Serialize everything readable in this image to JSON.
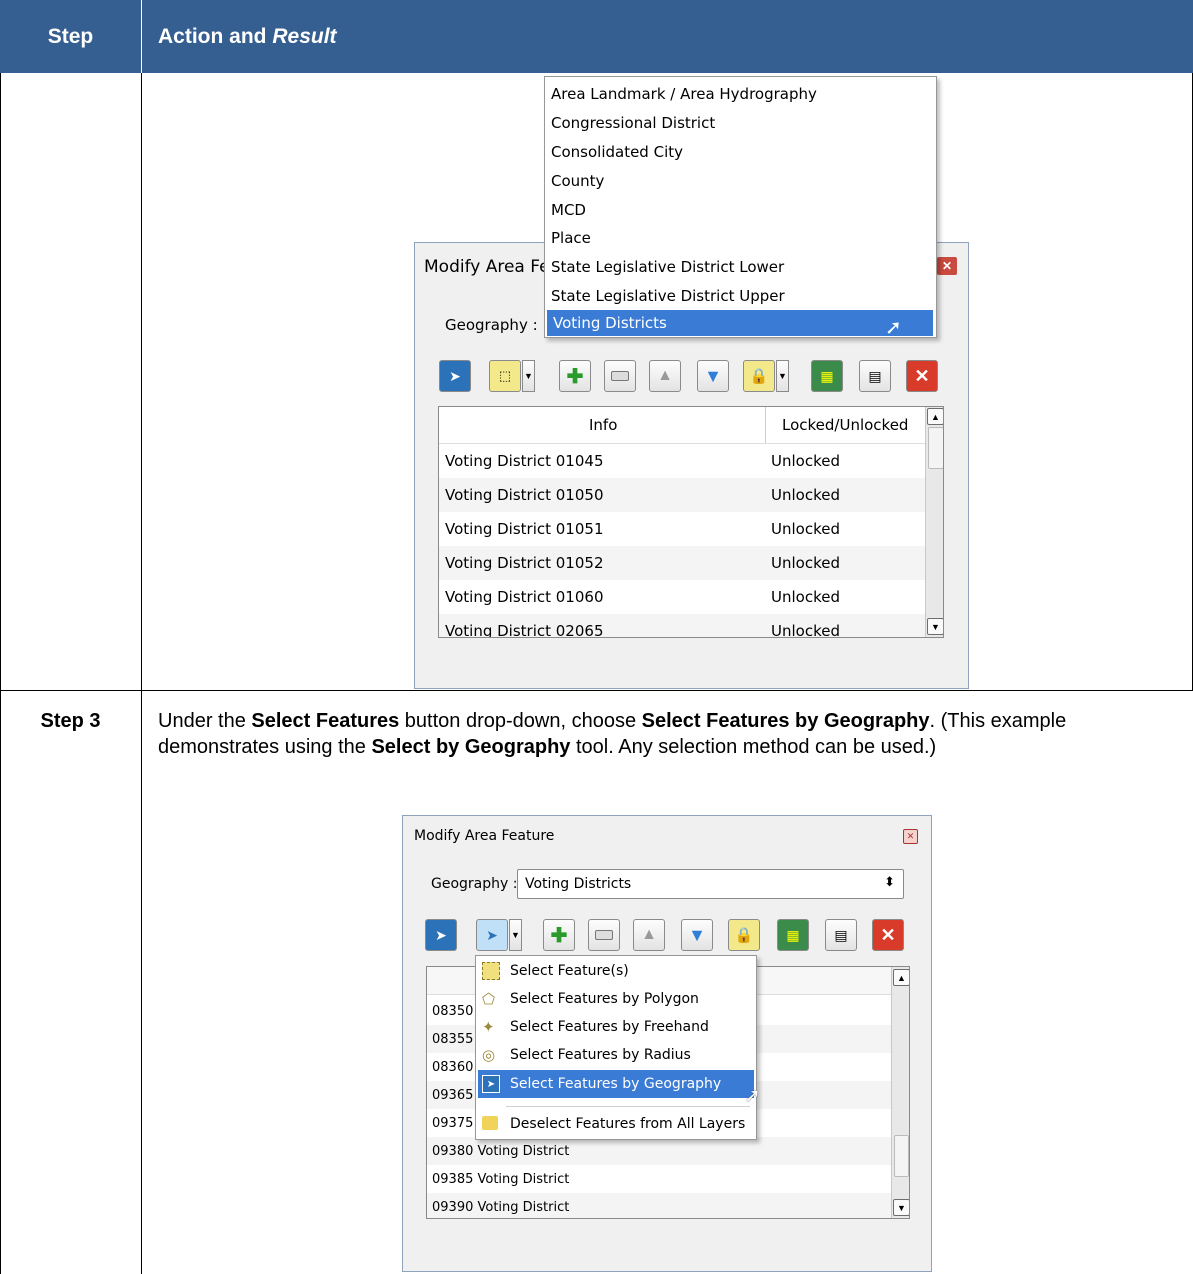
{
  "table": {
    "col_step": "Step",
    "col_action": "Action and",
    "col_action_italic": "Result"
  },
  "step3": {
    "label": "Step 3",
    "t1": "Under the ",
    "b1": "Select Features",
    "t2": " button drop-down, choose ",
    "b2": "Select Features by Geography",
    "t3": ". (This example demonstrates using the ",
    "b3": "Select by Geography",
    "t4": " tool. Any selection method can be used.)"
  },
  "window1": {
    "title": "Modify Area Fe",
    "geography_label": "Geography :",
    "columns": [
      "Info",
      "Locked/Unlocked"
    ],
    "rows": [
      {
        "info": "Voting District 01045",
        "status": "Unlocked"
      },
      {
        "info": "Voting District 01050",
        "status": "Unlocked"
      },
      {
        "info": "Voting District 01051",
        "status": "Unlocked"
      },
      {
        "info": "Voting District 01052",
        "status": "Unlocked"
      },
      {
        "info": "Voting District 01060",
        "status": "Unlocked"
      },
      {
        "info": "Voting District 02065",
        "status": "Unlocked"
      }
    ],
    "geography_options": [
      "Area Landmark / Area Hydrography",
      "Congressional District",
      "Consolidated City",
      "County",
      "MCD",
      "Place",
      "State Legislative District Lower",
      "State Legislative District Upper",
      "Voting Districts"
    ],
    "selected_option": "Voting Districts"
  },
  "window2": {
    "title": "Modify Area Feature",
    "geography_label": "Geography :",
    "geography_value": "Voting Districts",
    "rows": [
      "08350",
      "08355",
      "08360",
      "09365",
      "09375",
      "09380 Voting District",
      "09385 Voting District",
      "09390 Voting District"
    ],
    "select_menu": [
      "Select Feature(s)",
      "Select Features by Polygon",
      "Select Features by Freehand",
      "Select Features by Radius",
      "Select Features by Geography",
      "Deselect Features from All Layers"
    ]
  },
  "colors": {
    "header_bg": "#365f91",
    "highlight": "#3a7bd5"
  }
}
